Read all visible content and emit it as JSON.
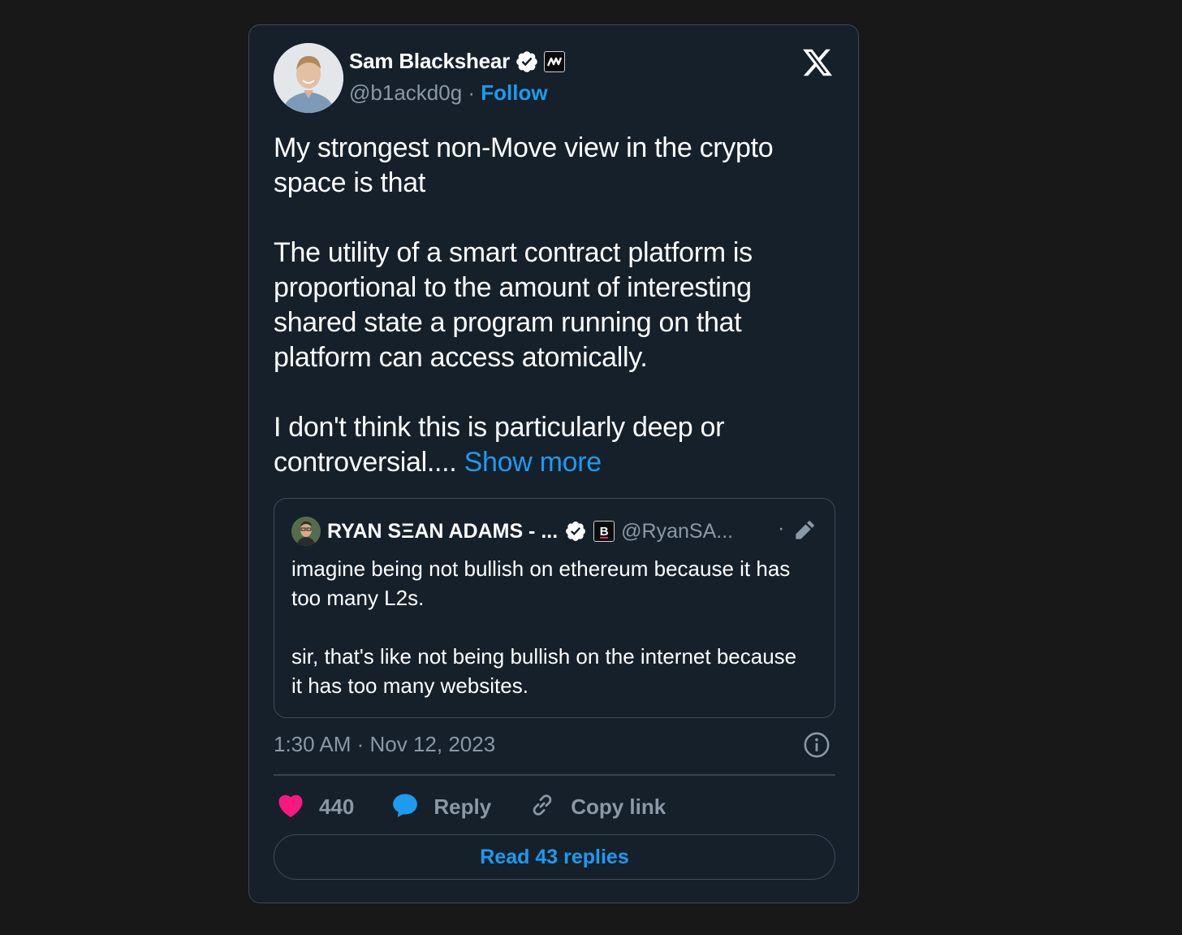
{
  "author": {
    "name": "Sam Blackshear",
    "handle": "@b1ackd0g",
    "separator": "·",
    "follow_label": "Follow"
  },
  "tweet": {
    "paragraphs": [
      "My strongest non-Move view in the crypto space is that",
      "The utility of a smart contract platform is proportional to the amount of interesting shared state a program running on that platform can access atomically.",
      "I don't think this is particularly deep or controversial...."
    ],
    "show_more_label": "Show more"
  },
  "quoted_tweet": {
    "name": "RYAN SΞAN ADAMS - ...",
    "badge_letter": "B",
    "handle": "@RyanSA...",
    "separator": "·",
    "paragraphs": [
      "imagine being not bullish on ethereum because it has too many L2s.",
      "sir, that's like not being bullish on the internet because it has too many websites."
    ]
  },
  "meta": {
    "timestamp": "1:30 AM · Nov 12, 2023"
  },
  "actions": {
    "like_count": "440",
    "reply_label": "Reply",
    "copy_link_label": "Copy link"
  },
  "read_replies_label": "Read 43 replies",
  "colors": {
    "background": "#181818",
    "card": "#15202b",
    "accent": "#1d9bf0",
    "like": "#f91880",
    "muted": "#8b98a5"
  },
  "icons": [
    "verified-icon",
    "affiliate-badge-icon",
    "x-logo-icon",
    "edit-icon",
    "info-icon",
    "heart-icon",
    "reply-bubble-icon",
    "link-icon"
  ]
}
